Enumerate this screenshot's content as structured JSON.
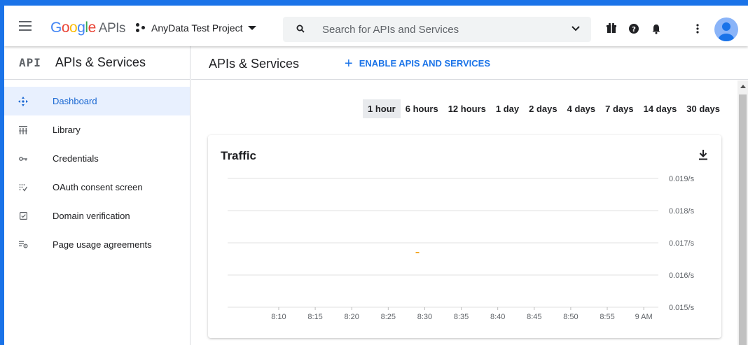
{
  "app": {
    "logo_google": "Google",
    "logo_apis": "APIs",
    "project_name": "AnyData Test Project"
  },
  "search": {
    "placeholder": "Search for APIs and Services"
  },
  "sidebar": {
    "api_logo": "API",
    "title": "APIs & Services",
    "items": [
      {
        "label": "Dashboard",
        "icon": "dashboard-icon",
        "active": true
      },
      {
        "label": "Library",
        "icon": "library-icon",
        "active": false
      },
      {
        "label": "Credentials",
        "icon": "key-icon",
        "active": false
      },
      {
        "label": "OAuth consent screen",
        "icon": "consent-icon",
        "active": false
      },
      {
        "label": "Domain verification",
        "icon": "checkbox-icon",
        "active": false
      },
      {
        "label": "Page usage agreements",
        "icon": "settings-list-icon",
        "active": false
      }
    ]
  },
  "main": {
    "title": "APIs & Services",
    "enable_label": "ENABLE APIS AND SERVICES",
    "time_ranges": [
      "1 hour",
      "6 hours",
      "12 hours",
      "1 day",
      "2 days",
      "4 days",
      "7 days",
      "14 days",
      "30 days"
    ],
    "selected_range": "1 hour"
  },
  "colors": {
    "accent": "#1a73e8",
    "active_bg": "#e8f0fe",
    "series": "#f29900"
  },
  "chart_data": {
    "type": "line",
    "title": "Traffic",
    "xlabel": "",
    "ylabel": "",
    "x": [
      "8:10",
      "8:15",
      "8:20",
      "8:25",
      "8:30",
      "8:35",
      "8:40",
      "8:45",
      "8:50",
      "8:55",
      "9 AM"
    ],
    "y_ticks": [
      "0.019/s",
      "0.018/s",
      "0.017/s",
      "0.016/s",
      "0.015/s"
    ],
    "ylim": [
      0.015,
      0.019
    ],
    "series": [
      {
        "points": [
          {
            "x": "8:29",
            "y": 0.0167
          }
        ]
      }
    ],
    "grid": true,
    "legend": "none"
  }
}
